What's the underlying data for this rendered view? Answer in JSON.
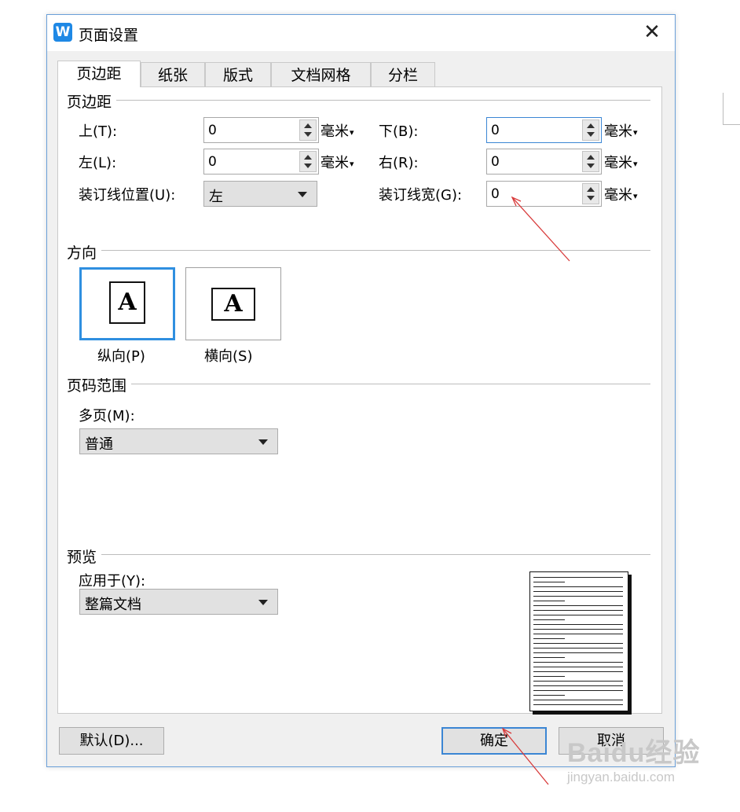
{
  "dialog": {
    "title": "页面设置",
    "app_icon_glyph": "W",
    "close_glyph": "✕"
  },
  "tabs": [
    {
      "label": "页边距",
      "active": true
    },
    {
      "label": "纸张",
      "active": false
    },
    {
      "label": "版式",
      "active": false
    },
    {
      "label": "文档网格",
      "active": false
    },
    {
      "label": "分栏",
      "active": false
    }
  ],
  "margins": {
    "section_title": "页边距",
    "top": {
      "label": "上(T):",
      "value": "0",
      "unit": "毫米"
    },
    "bottom": {
      "label": "下(B):",
      "value": "0",
      "unit": "毫米"
    },
    "left": {
      "label": "左(L):",
      "value": "0",
      "unit": "毫米"
    },
    "right": {
      "label": "右(R):",
      "value": "0",
      "unit": "毫米"
    },
    "gutter_pos": {
      "label": "装订线位置(U):",
      "value": "左"
    },
    "gutter": {
      "label": "装订线宽(G):",
      "value": "0",
      "unit": "毫米"
    },
    "unit_caret": "▾"
  },
  "orientation": {
    "section_title": "方向",
    "portrait": {
      "label": "纵向(P)",
      "letter": "A",
      "selected": true
    },
    "landscape": {
      "label": "横向(S)",
      "letter": "A",
      "selected": false
    }
  },
  "page_range": {
    "section_title": "页码范围",
    "multiple_label": "多页(M):",
    "multiple_value": "普通"
  },
  "preview": {
    "section_title": "预览",
    "apply_label": "应用于(Y):",
    "apply_value": "整篇文档"
  },
  "buttons": {
    "default": "默认(D)...",
    "ok": "确定",
    "cancel": "取消"
  },
  "watermark": {
    "brand": "Baidu经验",
    "url": "jingyan.baidu.com"
  },
  "colors": {
    "accent": "#3b86d4",
    "annotation_arrow": "#d83a3a"
  }
}
